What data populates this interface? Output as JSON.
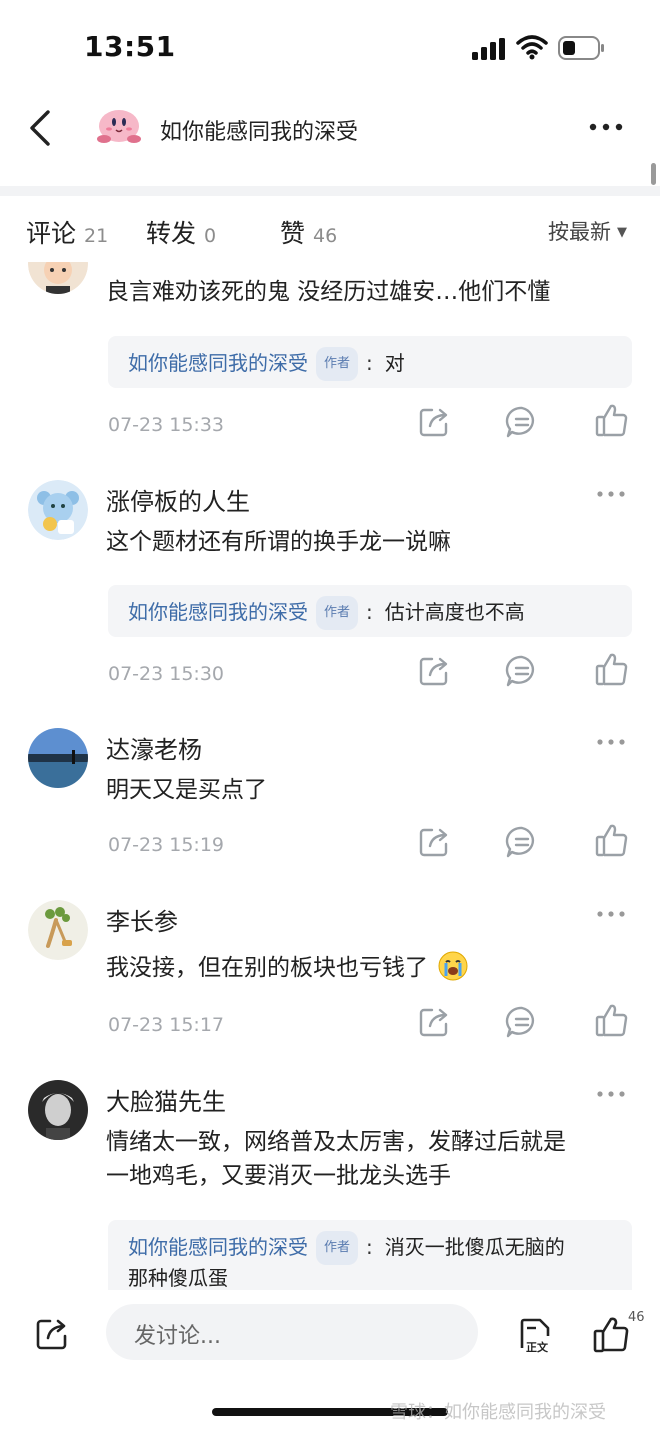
{
  "status_bar": {
    "time": "13:51"
  },
  "nav": {
    "title": "如你能感同我的深受"
  },
  "tabs": [
    {
      "label": "评论",
      "count": "21"
    },
    {
      "label": "转发",
      "count": "0"
    },
    {
      "label": "赞",
      "count": "46"
    }
  ],
  "sort": {
    "label": "按最新"
  },
  "author_badge": "作者",
  "comments": [
    {
      "username": "",
      "text": [
        "良言难劝该死的鬼 没经历过雄安…他们不懂"
      ],
      "reply": {
        "author": "如你能感同我的深受",
        "text": [
          "对"
        ]
      },
      "time": "07-23 15:33"
    },
    {
      "username": "涨停板的人生",
      "text": [
        "这个题材还有所谓的换手龙一说嘛"
      ],
      "reply": {
        "author": "如你能感同我的深受",
        "text": [
          "估计高度也不高"
        ]
      },
      "time": "07-23 15:30"
    },
    {
      "username": "达濠老杨",
      "text": [
        "明天又是买点了"
      ],
      "time": "07-23 15:19"
    },
    {
      "username": "李长参",
      "text": [
        "我没接，但在别的板块也亏钱了"
      ],
      "time": "07-23 15:17"
    },
    {
      "username": "大脸猫先生",
      "text": [
        "情绪太一致，网络普及太厉害，发酵过后就是",
        "一地鸡毛，又要消灭一批龙头选手"
      ],
      "reply": {
        "author": "如你能感同我的深受",
        "text": [
          "消灭一批傻瓜无脑的",
          "那种傻瓜蛋"
        ]
      },
      "time": ""
    }
  ],
  "bottom": {
    "input_placeholder": "发讨论...",
    "like_count": "46"
  },
  "watermark": "雪球：如你能感同我的深受",
  "colors": {
    "link": "#3e6ca8",
    "muted": "#a5a8ad",
    "reply_bg": "#f4f5f7"
  }
}
